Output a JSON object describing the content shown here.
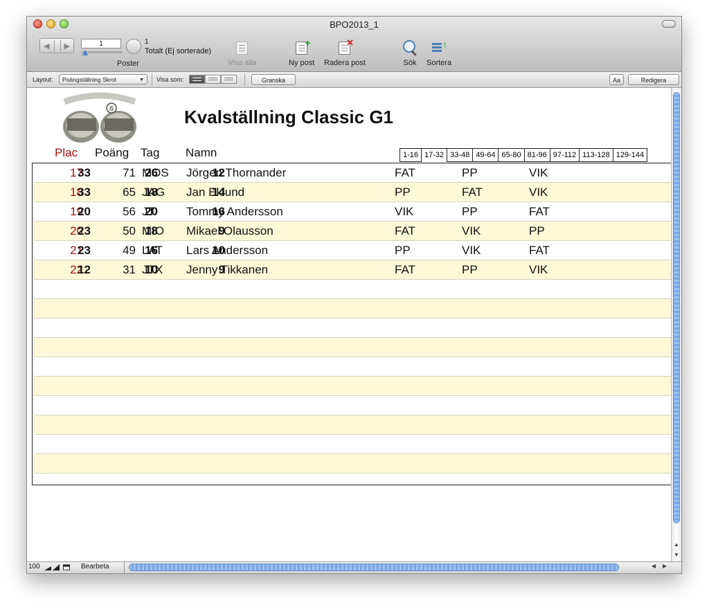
{
  "window": {
    "title": "BPO2013_1"
  },
  "toolbar": {
    "record_value": "1",
    "total_count": "1",
    "total_label": "Totalt (Ej sorterade)",
    "records_label": "Poster",
    "show_all_label": "Visa alla",
    "new_record_label": "Ny post",
    "delete_record_label": "Radera post",
    "find_label": "Sök",
    "sort_label": "Sortera"
  },
  "layoutbar": {
    "layout_label": "Layout:",
    "layout_value": "Poängställning Skrot",
    "view_as_label": "Visa som:",
    "preview_label": "Granska",
    "font_btn_label": "Aa",
    "edit_label": "Redigera"
  },
  "report": {
    "title": "Kvalställning Classic G1",
    "headers": {
      "plac": "Plac",
      "poang": "Poäng",
      "tag": "Tag",
      "namn": "Namn"
    },
    "tabs": [
      "1-16",
      "17-32",
      "33-48",
      "49-64",
      "65-80",
      "81-96",
      "97-112",
      "113-128",
      "129-144"
    ],
    "active_tab": "17-32",
    "rows": [
      {
        "plac": "17",
        "poang": "71",
        "tag": "MOS",
        "namn": "Jörgen Thornander",
        "s1": "33",
        "g1": "FAT",
        "s2": "26",
        "g2": "PP",
        "s3": "12",
        "g3": "VIK"
      },
      {
        "plac": "18",
        "poang": "65",
        "tag": "JAG",
        "namn": "Jan Eklund",
        "s1": "33",
        "g1": "PP",
        "s2": "18",
        "g2": "FAT",
        "s3": "14",
        "g3": "VIK"
      },
      {
        "plac": "19",
        "poang": "56",
        "tag": "JT",
        "namn": "Tommy Andersson",
        "s1": "20",
        "g1": "VIK",
        "s2": "20",
        "g2": "PP",
        "s3": "16",
        "g3": "FAT"
      },
      {
        "plac": "20",
        "poang": "50",
        "tag": "MIO",
        "namn": "Mikael Olausson",
        "s1": "23",
        "g1": "FAT",
        "s2": "18",
        "g2": "VIK",
        "s3": "9",
        "g3": "PP"
      },
      {
        "plac": "21",
        "poang": "49",
        "tag": "LAT",
        "namn": "Lars Andersson",
        "s1": "23",
        "g1": "PP",
        "s2": "16",
        "g2": "VIK",
        "s3": "10",
        "g3": "FAT"
      },
      {
        "plac": "22",
        "poang": "31",
        "tag": "JTX",
        "namn": "Jenny Tikkanen",
        "s1": "12",
        "g1": "FAT",
        "s2": "10",
        "g2": "PP",
        "s3": "9",
        "g3": "VIK"
      }
    ],
    "empty_rows": 10
  },
  "statusbar": {
    "zoom": "100",
    "mode": "Bearbeta"
  },
  "colors": {
    "placement_red": "#a31212",
    "alt_row": "#fdf8d8",
    "scroll_blue": "#7aa7e6"
  }
}
